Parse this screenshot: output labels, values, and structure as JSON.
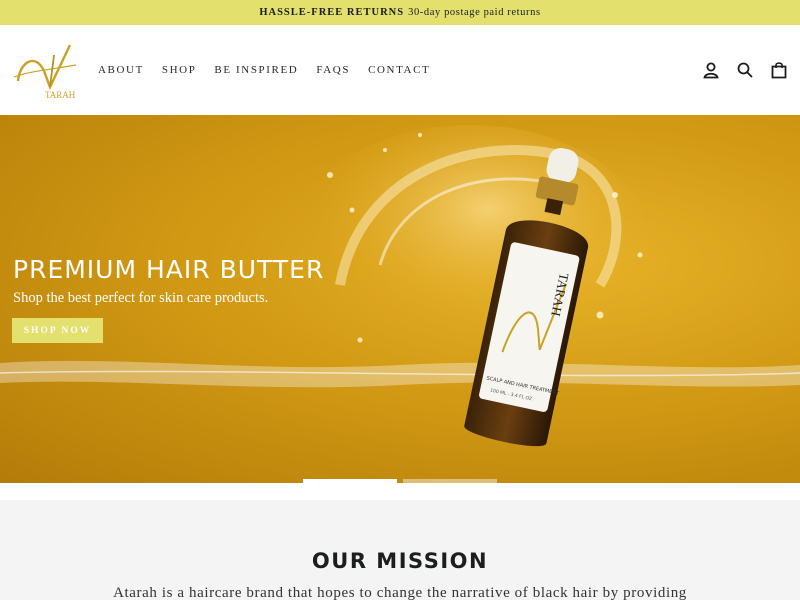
{
  "announcement": {
    "bold": "HASSLE-FREE RETURNS",
    "text": "30-day postage paid returns",
    "bg_color": "#e3e06e"
  },
  "header": {
    "logo_text": "TARAH",
    "nav": [
      "ABOUT",
      "SHOP",
      "BE INSPIRED",
      "FAQS",
      "CONTACT"
    ],
    "icons": [
      "user-icon",
      "search-icon",
      "cart-icon"
    ]
  },
  "hero": {
    "title": "PREMIUM HAIR BUTTER",
    "subtitle": "Shop the best perfect for skin care products.",
    "button_label": "SHOP NOW",
    "bottle_brand": "TARAH",
    "bottle_label": "SCALP AND HAIR TREATMENT",
    "bottle_volume": "100 ML - 3.4 FL OZ",
    "slides": 2,
    "active_slide": 1,
    "accent": "#e3e06e"
  },
  "mission": {
    "title": "OUR MISSION",
    "text": "Atarah is a haircare brand that hopes to change the narrative of black hair by providing"
  }
}
